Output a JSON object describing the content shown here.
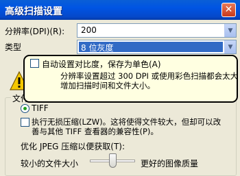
{
  "window": {
    "title": "高级扫描设置",
    "close_glyph": "✕"
  },
  "resolution": {
    "label": "分辨率(DPI)(R):",
    "value": "200"
  },
  "type": {
    "label": "类型",
    "value": "8 位灰度"
  },
  "tooltip": {
    "checkbox_label": "自动设置对比度，保存为单色(A)",
    "message_line1": "分辨率设置超过 300 DPI 或使用彩色扫描都会太大",
    "message_line2": "增加扫描时间和文件大小。"
  },
  "file_save_group": {
    "label": "文件另存为"
  },
  "tiff": {
    "label": "TIFF",
    "selected": true
  },
  "lzw": {
    "label_line1": "执行无损压缩(LZW)。这将使得文件较大，但却可以改",
    "label_line2": "善与其他 TIFF 查看器的兼容性(P)。"
  },
  "jpeg": {
    "label": "优化 JPEG 压缩以便获取(T):",
    "min_label": "较小的文件大小",
    "max_label": "更好的图像质量",
    "quality_level": 0.5
  },
  "colors": {
    "title_bar": "#0054E3",
    "tooltip_bg": "#FFFFE1",
    "selection": "#316AC5"
  }
}
